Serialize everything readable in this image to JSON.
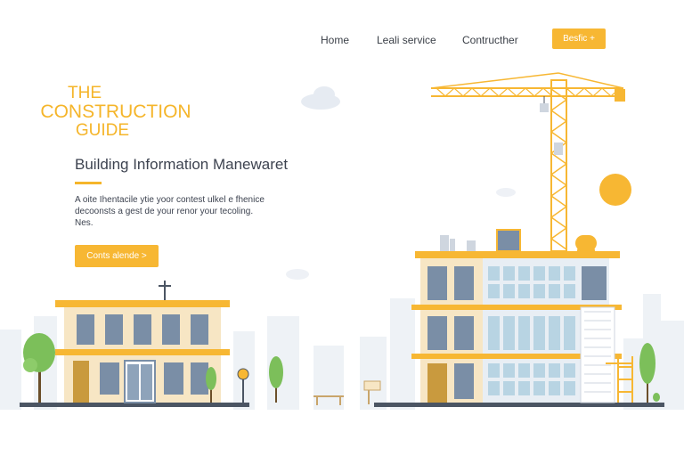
{
  "nav": {
    "links": [
      "Home",
      "Leali service",
      "Contructher"
    ],
    "cta_label": "Besfic +"
  },
  "hero": {
    "brand_line1": "THE",
    "brand_line2": "CONSTRUCTION",
    "brand_line3": "GUIDE",
    "headline": "Building Information Manewaret",
    "body_line1": "A oite Ihentacile ytie yoor contest ulkel e fhenice",
    "body_line2": "decoonsts a gest de your renor your tecoling.",
    "body_line3": "Nes.",
    "cta_label": "Conts alende >"
  },
  "colors": {
    "accent": "#f5b52a",
    "text": "#3d4350",
    "window": "#7a8ea6",
    "building_wall": "#f7e6c4",
    "glass": "#b8d4e3"
  }
}
